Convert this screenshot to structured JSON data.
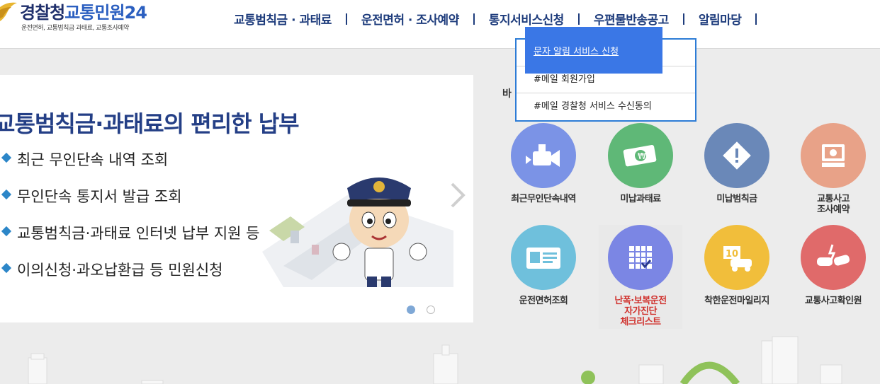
{
  "header": {
    "logo_a": "경찰청",
    "logo_b": "교통민원24",
    "logo_sub": "운전면허, 교통범칙금 과태료, 교통조사예약",
    "nav": [
      "교통범칙금 · 과태료",
      "운전면허 · 조사예약",
      "통지서비스신청",
      "우편물반송공고",
      "알림마당"
    ]
  },
  "dropdown": {
    "items": [
      "문자 알림 서비스 신청",
      "#메일 회원가입",
      "#메일 경찰청 서비스 수신동의"
    ]
  },
  "banner": {
    "title": "교통범칙금·과태료의 편리한 납부",
    "items": [
      "최근 무인단속 내역 조회",
      "무인단속 통지서 발급 조회",
      "교통범칙금·과태료 인터넷 납부 지원 등",
      "이의신청·과오납환급 등 민원신청"
    ]
  },
  "services": {
    "label_partial": "바",
    "items": [
      {
        "label": "최근무인단속내역",
        "icon": "camera-icon",
        "color": "#7b93e6"
      },
      {
        "label": "미납과태료",
        "icon": "money-icon",
        "color": "#5fb877"
      },
      {
        "label": "미납범칙금",
        "icon": "warning-icon",
        "color": "#6a88b8"
      },
      {
        "label": "교통사고\n조사예약",
        "icon": "computer-icon",
        "color": "#e8a288"
      },
      {
        "label": "운전면허조회",
        "icon": "license-icon",
        "color": "#6fc0dc"
      },
      {
        "label": "난폭·보복운전\n자가진단\n체크리스트",
        "icon": "checklist-icon",
        "color": "#7b86e4"
      },
      {
        "label": "착한운전마일리지",
        "icon": "mileage-icon",
        "color": "#f1be3b"
      },
      {
        "label": "교통사고확인원",
        "icon": "accident-icon",
        "color": "#e06a6a"
      }
    ]
  }
}
